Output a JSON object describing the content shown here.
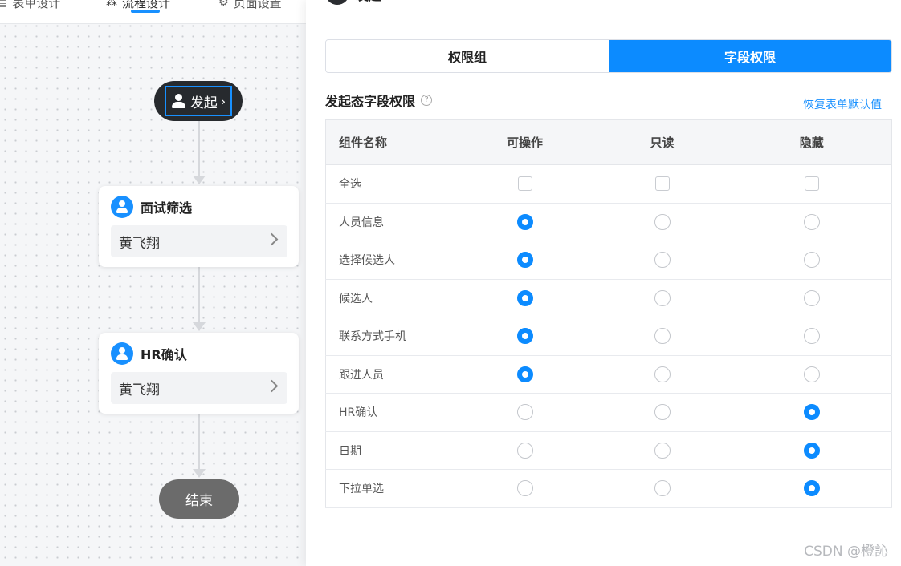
{
  "canvas": {
    "nav_tabs": [
      {
        "label": "表单设计",
        "icon": "form-icon"
      },
      {
        "label": "流程设计",
        "icon": "flow-icon",
        "active": true
      },
      {
        "label": "页面设置",
        "icon": "gear-icon"
      }
    ],
    "start_node": {
      "label": "发起"
    },
    "nodes": [
      {
        "title": "面试筛选",
        "assignee": "黄飞翔"
      },
      {
        "title": "HR确认",
        "assignee": "黄飞翔"
      }
    ],
    "end_node": {
      "label": "结束"
    }
  },
  "panel": {
    "title": "发起",
    "segments": {
      "group_label": "权限组",
      "field_label": "字段权限",
      "active": "field"
    },
    "section_title": "发起态字段权限",
    "help_icon": "?",
    "restore_link": "恢复表单默认值",
    "table": {
      "headers": [
        "组件名称",
        "可操作",
        "只读",
        "隐藏"
      ],
      "select_all_label": "全选",
      "rows": [
        {
          "name": "人员信息",
          "selected": "operable"
        },
        {
          "name": "选择候选人",
          "selected": "operable"
        },
        {
          "name": "候选人",
          "selected": "operable"
        },
        {
          "name": "联系方式手机",
          "selected": "operable"
        },
        {
          "name": "跟进人员",
          "selected": "operable"
        },
        {
          "name": "HR确认",
          "selected": "hidden"
        },
        {
          "name": "日期",
          "selected": "hidden"
        },
        {
          "name": "下拉单选",
          "selected": "hidden"
        }
      ]
    }
  },
  "watermark": "CSDN @橙訫",
  "colors": {
    "accent": "#0c8bff",
    "start_node": "#272a2e",
    "end_node": "#6b6b6b"
  }
}
